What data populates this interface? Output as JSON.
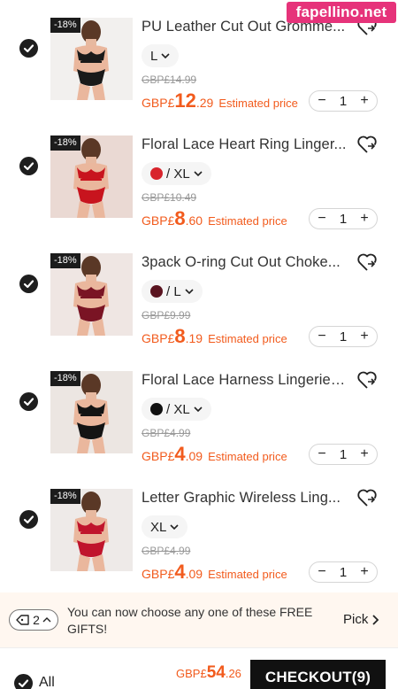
{
  "watermark": "fapellino.net",
  "colors": {
    "accent": "#f25b1d",
    "dark": "#111111",
    "gift_bg": "#fff7f0"
  },
  "cart": {
    "items": [
      {
        "discount": "-18%",
        "title": "PU Leather Cut Out Gromme...",
        "variant": "L",
        "swatch": null,
        "original_price": "GBP£14.99",
        "price_currency": "GBP£",
        "price_main": "12",
        "price_fraction": ".29",
        "price_note": "Estimated price",
        "quantity": "1",
        "product_color": "#1a1a1a",
        "bg_color": "#f2f0ee"
      },
      {
        "discount": "-18%",
        "title": "Floral Lace Heart Ring Linger...",
        "variant": "/ XL",
        "swatch": "#d8242c",
        "original_price": "GBP£10.49",
        "price_currency": "GBP£",
        "price_main": "8",
        "price_fraction": ".60",
        "price_note": "Estimated price",
        "quantity": "1",
        "product_color": "#c8141e",
        "bg_color": "#ead9d3"
      },
      {
        "discount": "-18%",
        "title": "3pack O-ring Cut Out Choke...",
        "variant": "/ L",
        "swatch": "#5a1420",
        "original_price": "GBP£9.99",
        "price_currency": "GBP£",
        "price_main": "8",
        "price_fraction": ".19",
        "price_note": "Estimated price",
        "quantity": "1",
        "product_color": "#7a1424",
        "bg_color": "#efe6e3"
      },
      {
        "discount": "-18%",
        "title": "Floral Lace Harness Lingerie ...",
        "variant": "/ XL",
        "swatch": "#111111",
        "original_price": "GBP£4.99",
        "price_currency": "GBP£",
        "price_main": "4",
        "price_fraction": ".09",
        "price_note": "Estimated price",
        "quantity": "1",
        "product_color": "#141414",
        "bg_color": "#ece6e2"
      },
      {
        "discount": "-18%",
        "title": "Letter Graphic Wireless Ling...",
        "variant": "XL",
        "swatch": null,
        "original_price": "GBP£4.99",
        "price_currency": "GBP£",
        "price_main": "4",
        "price_fraction": ".09",
        "price_note": "Estimated price",
        "quantity": "1",
        "product_color": "#c0142c",
        "bg_color": "#eeeae8"
      }
    ]
  },
  "gift_bar": {
    "coupon_count": "2",
    "message": "You can now choose any one of these FREE GIFTS!",
    "pick_label": "Pick"
  },
  "footer": {
    "all_label": "All",
    "total_currency": "GBP£",
    "total_main": "54",
    "total_fraction": ".26",
    "checkout_label": "CHECKOUT(9)"
  }
}
